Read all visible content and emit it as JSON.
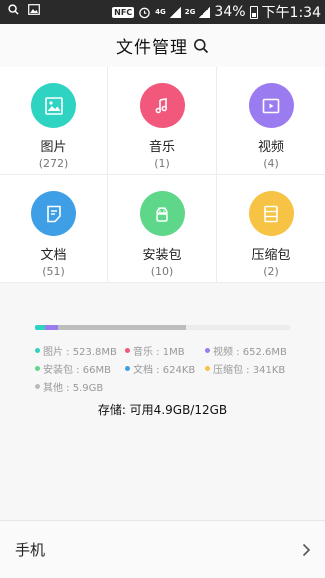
{
  "statusbar": {
    "nfc": "NFC",
    "net1": "4G",
    "net2": "2G",
    "battery": "34%",
    "time": "下午1:34"
  },
  "header": {
    "title": "文件管理"
  },
  "categories": [
    {
      "label": "图片",
      "count": "(272)",
      "color": "#2fd3c2",
      "icon": "image-icon"
    },
    {
      "label": "音乐",
      "count": "(1)",
      "color": "#f1587c",
      "icon": "music-icon"
    },
    {
      "label": "视频",
      "count": "(4)",
      "color": "#9b7cf0",
      "icon": "video-icon"
    },
    {
      "label": "文档",
      "count": "(51)",
      "color": "#3e9fe6",
      "icon": "document-icon"
    },
    {
      "label": "安装包",
      "count": "(10)",
      "color": "#5fd78a",
      "icon": "android-icon"
    },
    {
      "label": "压缩包",
      "count": "(2)",
      "color": "#f7c344",
      "icon": "archive-icon"
    }
  ],
  "legend": [
    {
      "text": "图片 : 523.8MB",
      "color": "#2fd3c2"
    },
    {
      "text": "音乐 : 1MB",
      "color": "#f1587c"
    },
    {
      "text": "视频 : 652.6MB",
      "color": "#9b7cf0"
    },
    {
      "text": "安装包 : 66MB",
      "color": "#5fd78a"
    },
    {
      "text": "文档 : 624KB",
      "color": "#3e9fe6"
    },
    {
      "text": "压缩包 : 341KB",
      "color": "#f7c344"
    },
    {
      "text": "其他 : 5.9GB",
      "color": "#bbbbbb"
    }
  ],
  "storage": {
    "text": "存储: 可用4.9GB/12GB"
  },
  "phone": {
    "label": "手机"
  }
}
